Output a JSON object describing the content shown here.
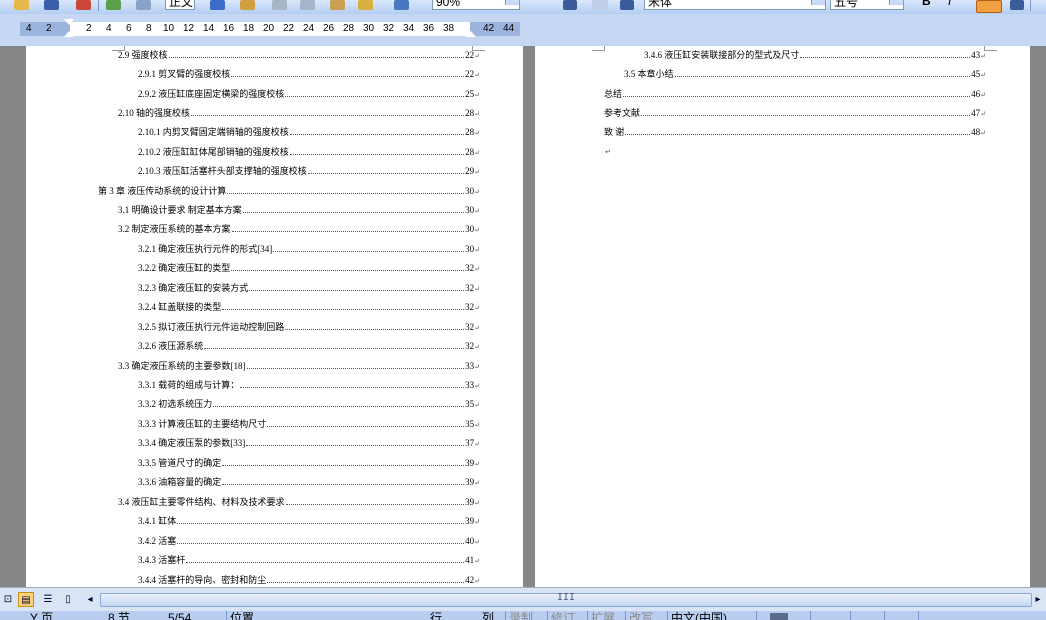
{
  "toolbar": {
    "style_box": "正文",
    "zoom_box": "90%",
    "font_box": "宋体",
    "size_box": "五号",
    "bold": "B",
    "italic": "I"
  },
  "ruler": {
    "ticks": [
      "4",
      "2",
      "2",
      "4",
      "6",
      "8",
      "10",
      "12",
      "14",
      "16",
      "18",
      "20",
      "22",
      "24",
      "26",
      "28",
      "30",
      "32",
      "34",
      "36",
      "38",
      "42",
      "44"
    ]
  },
  "left_toc": [
    {
      "text": "2.9  强度校核",
      "page": "22"
    },
    {
      "text": "2.9.1  剪叉臂的强度校核",
      "page": "22"
    },
    {
      "text": "2.9.2    液压缸底座固定横梁的强度校核",
      "page": "25"
    },
    {
      "text": "2.10  轴的强度校核",
      "page": "28"
    },
    {
      "text": "2.10.1  内剪叉臂固定端销轴的强度校核",
      "page": "28"
    },
    {
      "text": "2.10.2  液压缸缸体尾部销轴的强度校核",
      "page": "28"
    },
    {
      "text": "2.10.3  液压缸活塞杆头部支撑轴的强度校核",
      "page": "29"
    },
    {
      "text": "第 3 章  液压传动系统的设计计算",
      "page": "30"
    },
    {
      "text": "3.1 明确设计要求  制定基本方案",
      "page": "30"
    },
    {
      "text": "3.2 制定液压系统的基本方案",
      "page": "30"
    },
    {
      "text": "3.2.1 确定液压执行元件的形式[34]",
      "page": "30"
    },
    {
      "text": "3.2.2  确定液压缸的类型",
      "page": "32"
    },
    {
      "text": "3.2.3  确定液压缸的安装方式",
      "page": "32"
    },
    {
      "text": "3.2.4  缸盖联接的类型",
      "page": "32"
    },
    {
      "text": "3.2.5 拟订液压执行元件运动控制回路",
      "page": "32"
    },
    {
      "text": "3.2.6 液压源系统",
      "page": "32"
    },
    {
      "text": "3.3 确定液压系统的主要参数[18]",
      "page": "33"
    },
    {
      "text": "3.3.1 载荷的组成与计算：",
      "page": "33"
    },
    {
      "text": "3.3.2 初选系统压力",
      "page": "35"
    },
    {
      "text": "3.3.3 计算液压缸的主要结构尺寸",
      "page": "35"
    },
    {
      "text": "3.3.4 确定液压泵的参数[33]",
      "page": "37"
    },
    {
      "text": "3.3.5 管道尺寸的确定",
      "page": "39"
    },
    {
      "text": "3.3.6 油箱容量的确定",
      "page": "39"
    },
    {
      "text": "3.4 液压缸主要零件结构、材料及技术要求",
      "page": "39"
    },
    {
      "text": "3.4.1 缸体",
      "page": "39"
    },
    {
      "text": "3.4.2 活塞",
      "page": "40"
    },
    {
      "text": "3.4.3 活塞杆",
      "page": "41"
    },
    {
      "text": "3.4.4 活塞杆的导向、密封和防尘",
      "page": "42"
    }
  ],
  "right_toc": [
    {
      "text": "3.4.6 液压缸安装联接部分的型式及尺寸",
      "page": "43"
    },
    {
      "text": "3.5  本章小结",
      "page": "45"
    },
    {
      "text": "总结",
      "page": "46"
    },
    {
      "text": "参考文献",
      "page": "47"
    },
    {
      "text": "致  谢",
      "page": "48"
    }
  ],
  "paragraph_mark": "↵",
  "scrollbar": {
    "thumb_grip": "III"
  },
  "status": {
    "page": "Y 页",
    "section": "8 节",
    "pages": "5/54",
    "position": "位置",
    "line": "行",
    "column": "列",
    "rec": "录制",
    "trk": "修订",
    "ext": "扩展",
    "ovr": "改写",
    "lang": "中文(中国)"
  }
}
